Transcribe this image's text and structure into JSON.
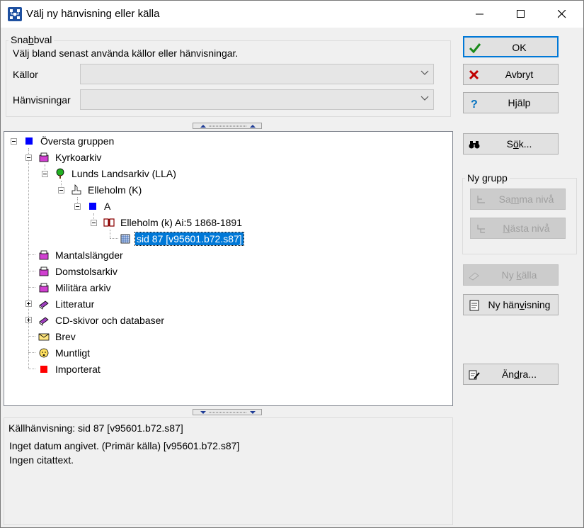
{
  "window": {
    "title": "Välj ny hänvisning eller källa"
  },
  "quick": {
    "legend_pre": "Sna",
    "legend_u": "b",
    "legend_post": "bval",
    "description": "Välj bland senast använda källor eller hänvisningar.",
    "sources_label": "Källor",
    "sources_value": "",
    "refs_label": "Hänvisningar",
    "refs_value": ""
  },
  "tree": {
    "items": [
      {
        "label": "Översta gruppen",
        "icon": "blue-square-icon"
      },
      {
        "label": "Kyrkoarkiv",
        "icon": "folder-archive-icon"
      },
      {
        "label": "Lunds Landsarkiv (LLA)",
        "icon": "green-tree-icon"
      },
      {
        "label": "Elleholm (K)",
        "icon": "church-icon"
      },
      {
        "label": "A",
        "icon": "blue-square-icon"
      },
      {
        "label": "Elleholm (k) Ai:5 1868-1891",
        "icon": "book-icon"
      },
      {
        "label": "sid  87 [v95601.b72.s87]",
        "icon": "page-grid-icon"
      },
      {
        "label": "Mantalslängder",
        "icon": "folder-archive-icon"
      },
      {
        "label": "Domstolsarkiv",
        "icon": "folder-archive-icon"
      },
      {
        "label": "Militära arkiv",
        "icon": "folder-archive-icon"
      },
      {
        "label": "Litteratur",
        "icon": "books-icon"
      },
      {
        "label": "CD-skivor och databaser",
        "icon": "books-icon"
      },
      {
        "label": "Brev",
        "icon": "envelope-icon"
      },
      {
        "label": "Muntligt",
        "icon": "face-icon"
      },
      {
        "label": "Importerat",
        "icon": "red-square-icon"
      }
    ]
  },
  "detail": {
    "legend": "Källhänvisning: sid  87 [v95601.b72.s87]",
    "line1": "Inget datum angivet. (Primär källa) [v95601.b72.s87]",
    "line2": "Ingen citattext."
  },
  "buttons": {
    "ok": "OK",
    "cancel": "Avbryt",
    "help_pre": "H",
    "help_u": "j",
    "help_post": "älp",
    "search_pre": "S",
    "search_u": "ö",
    "search_post": "k...",
    "new_group_legend": "Ny grupp",
    "same_level_pre": "Sa",
    "same_level_u": "m",
    "same_level_post": "ma nivå",
    "next_level_pre": "",
    "next_level_u": "N",
    "next_level_post": "ästa nivå",
    "new_source_pre": "Ny ",
    "new_source_u": "k",
    "new_source_post": "älla",
    "new_ref_pre": "Ny hän",
    "new_ref_u": "v",
    "new_ref_post": "isning",
    "edit_pre": "Än",
    "edit_u": "d",
    "edit_post": "ra..."
  },
  "colors": {
    "selection": "#0078d7",
    "accent_blue": "#0000ff",
    "accent_red": "#ff0000"
  }
}
